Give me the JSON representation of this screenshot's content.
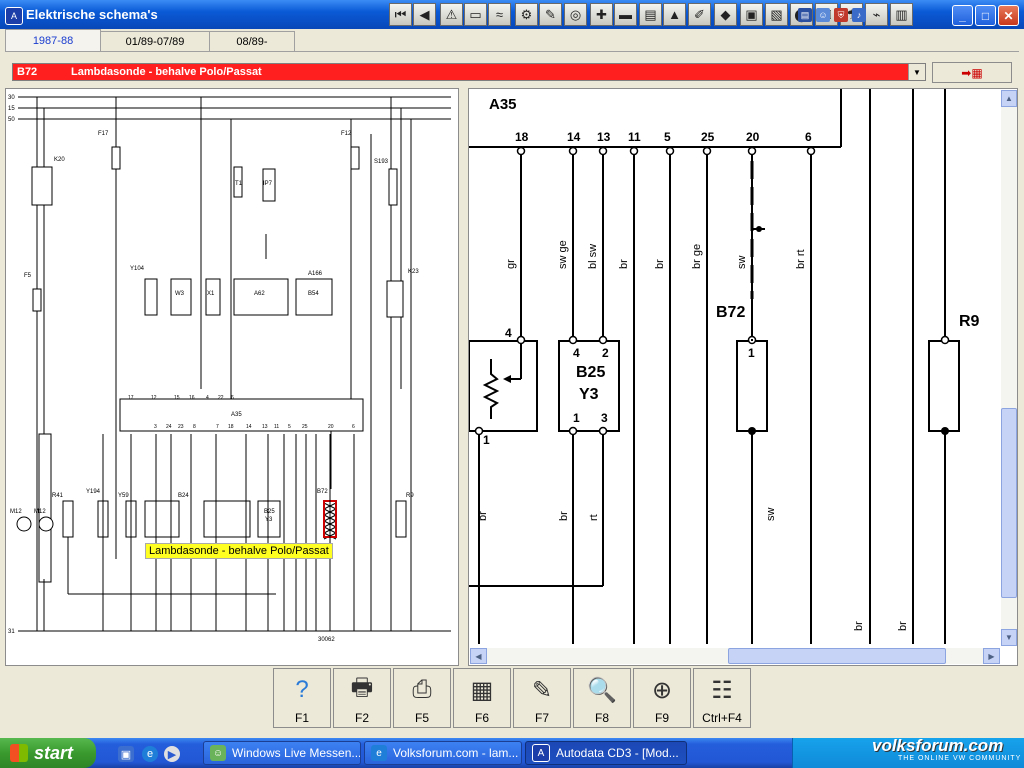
{
  "window": {
    "title": "Elektrische schema's",
    "icon": "autodata-icon"
  },
  "toolbar": {
    "icons": [
      "first-page-icon",
      "previous-icon",
      "warning-icon",
      "document-icon",
      "water-icon",
      "gear-icon",
      "tools-icon",
      "gauge-icon",
      "wrench-icon",
      "battery-icon",
      "seat-icon",
      "fluid-icon",
      "injector-icon",
      "belt-icon",
      "ecu-icon",
      "car-icon",
      "wheel-icon",
      "key-icon",
      "airbag-icon",
      "wire-icon",
      "book-icon"
    ],
    "glyphs": [
      "⏮",
      "◀",
      "⚠",
      "▭",
      "≈",
      "⚙",
      "✎",
      "◎",
      "✚",
      "▬",
      "▤",
      "▲",
      "✐",
      "◆",
      "▣",
      "▧",
      "⬤",
      "⚿",
      "☂",
      "⌁",
      "▥"
    ]
  },
  "tabs": [
    {
      "label": "1987-88",
      "active": true
    },
    {
      "label": "01/89-07/89",
      "active": false
    },
    {
      "label": "08/89-",
      "active": false
    }
  ],
  "selector": {
    "code": "B72",
    "description": "Lambdasonde - behalve Polo/Passat",
    "bg_color": "#ff1f1f"
  },
  "tooltip": "Lambdasonde - behalve Polo/Passat",
  "overview": {
    "rails": [
      "30",
      "15",
      "50",
      "31"
    ],
    "fuses": [
      "F17",
      "F12",
      "F5"
    ],
    "components": [
      "K20",
      "F17",
      "F12",
      "S193",
      "T1",
      "IP7",
      "Y104",
      "W3",
      "X1",
      "A62",
      "B54",
      "A166",
      "K23",
      "A35",
      "M12",
      "M12",
      "R41",
      "Y194",
      "Y59",
      "B24",
      "B25",
      "Y3",
      "B72",
      "R9"
    ],
    "pins": [
      "17",
      "12",
      "15",
      "16",
      "4",
      "22",
      "6",
      "3",
      "24",
      "23",
      "8",
      "7",
      "18",
      "14",
      "13",
      "11",
      "5",
      "25",
      "20",
      "6"
    ],
    "ref": "30062"
  },
  "detail": {
    "module": "A35",
    "pins": [
      "18",
      "14",
      "13",
      "11",
      "5",
      "25",
      "20",
      "6"
    ],
    "wire_colors_top": [
      "gr",
      "sw ge",
      "bl sw",
      "br",
      "br",
      "br ge",
      "sw",
      "br rt"
    ],
    "wire_colors_bottom": [
      "br",
      "br",
      "rt",
      "sw",
      "br",
      "br"
    ],
    "components": {
      "b25": "B25",
      "y3": "Y3",
      "b72": "B72",
      "r9": "R9"
    },
    "comp_pins": {
      "b25_tl": "4",
      "b25_tr": "2",
      "b25_bl": "1",
      "b25_br": "3",
      "left_top": "4",
      "left_bottom": "1",
      "b72_top": "1"
    }
  },
  "fkeys": [
    {
      "label": "F1",
      "icon": "help-icon",
      "glyph": "?"
    },
    {
      "label": "F2",
      "icon": "printer-icon",
      "glyph": "🖶"
    },
    {
      "label": "F5",
      "icon": "print-icon",
      "glyph": "⎙"
    },
    {
      "label": "F6",
      "icon": "fuse-box-icon",
      "glyph": "▦"
    },
    {
      "label": "F7",
      "icon": "eraser-icon",
      "glyph": "✎"
    },
    {
      "label": "F8",
      "icon": "magnify-component-icon",
      "glyph": "🔍"
    },
    {
      "label": "F9",
      "icon": "zoom-icon",
      "glyph": "⊕"
    },
    {
      "label": "Ctrl+F4",
      "icon": "table-icon",
      "glyph": "☷"
    }
  ],
  "taskbar": {
    "start": "start",
    "tasks": [
      {
        "label": "Windows Live Messen...",
        "icon": "messenger-icon",
        "active": false
      },
      {
        "label": "Volksforum.com - lam...",
        "icon": "ie-icon",
        "active": false
      },
      {
        "label": "Autodata CD3 - [Mod...",
        "icon": "autodata-icon",
        "active": true
      }
    ],
    "watermark": "volksforum.com",
    "watermark_tag": "THE ONLINE VW COMMUNITY"
  }
}
